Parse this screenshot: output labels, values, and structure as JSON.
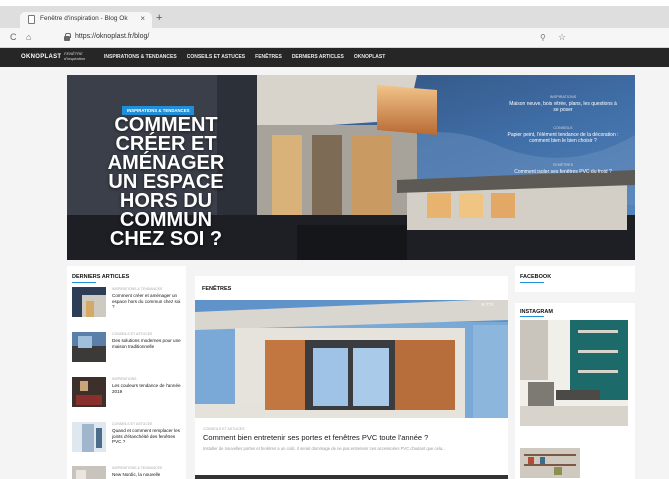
{
  "browser": {
    "tab_title": "Fenêtre d'inspiration - Blog Ok",
    "tab_close": "×",
    "new_tab": "+",
    "back": "C",
    "home": "⌂",
    "url": "https://oknoplast.fr/blog/"
  },
  "site": {
    "logo": "OKNOPLAST",
    "logo_sub": "FENÊTRE d'inspiration",
    "nav": [
      "INSPIRATIONS & TENDANCES",
      "CONSEILS ET ASTUCES",
      "FENÊTRES",
      "DERNIERS ARTICLES",
      "OKNOPLAST"
    ]
  },
  "hero": {
    "tag": "INSPIRATIONS & TENDANCES",
    "title": "COMMENT CRÉER ET AMÉNAGER UN ESPACE HORS DU COMMUN CHEZ SOI ?",
    "side_links": [
      {
        "category": "INSPIRATIONS",
        "text": "Maison neuve, bois vitrée, plans, les questions à se poser"
      },
      {
        "category": "CONSEILS",
        "text": "Papier peint, l'élément tendance de la décoration : comment bien le bien choisir ?"
      },
      {
        "category": "FENÊTRES",
        "text": "Comment isoler ses fenêtres PVC du froid ?"
      }
    ]
  },
  "sidebar_left": {
    "title": "DERNIERS ARTICLES",
    "items": [
      {
        "category": "INSPIRATIONS & TENDANCES",
        "title": "Comment créer et aménager un espace hors du commun chez soi ?"
      },
      {
        "category": "CONSEILS ET ASTUCES",
        "title": "Des solutions modernes pour une maison traditionnelle"
      },
      {
        "category": "INSPIRATIONS",
        "title": "Les couleurs tendance de l'année 2019"
      },
      {
        "category": "CONSEILS ET ASTUCES",
        "title": "Quand et comment remplacer les joints d'étanchéité des fenêtres PVC ?"
      },
      {
        "category": "INSPIRATIONS & TENDANCES",
        "title": "New Nordic, la nouvelle"
      }
    ]
  },
  "main": {
    "section_title": "FENÊTRES",
    "badge": "✉ 774",
    "category": "CONSEILS ET ASTUCES",
    "article_title": "Comment bien entretenir ses portes et fenêtres PVC toute l'année ?",
    "excerpt": "Installer de nouvelles portes et fenêtres a un coût. Il serait dommage de ne pas entretenir ces accessoires PVC d'autant que cela..."
  },
  "sidebar_right": {
    "facebook_title": "FACEBOOK",
    "instagram_title": "INSTAGRAM"
  },
  "colors": {
    "accent": "#1f8fd9",
    "nav_bg": "#262626",
    "page_bg": "#f4f4f4"
  }
}
